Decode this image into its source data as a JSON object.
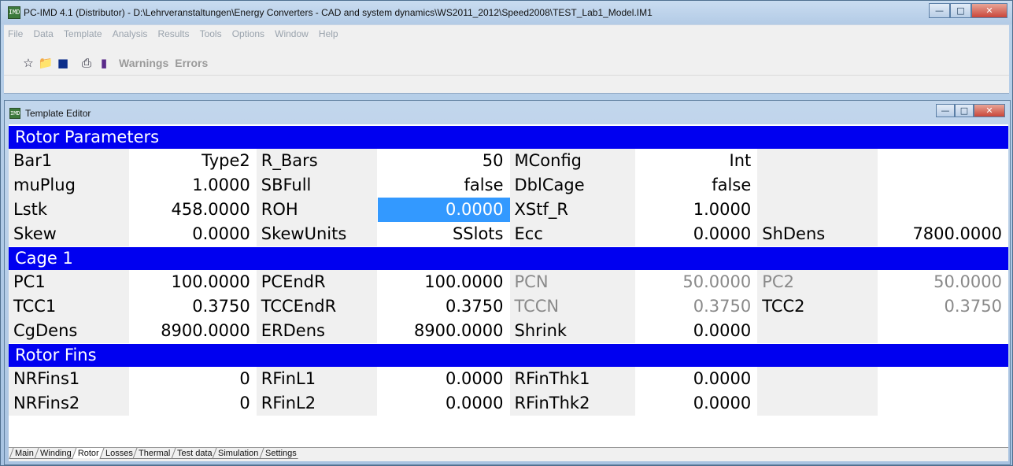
{
  "app": {
    "title": "PC-IMD 4.1 (Distributor) - D:\\Lehrveranstaltungen\\Energy Converters - CAD and system dynamics\\WS2011_2012\\Speed2008\\TEST_Lab1_Model.IM1",
    "icon_text": "IMD"
  },
  "menu": [
    "File",
    "Data",
    "Template",
    "Analysis",
    "Results",
    "Tools",
    "Options",
    "Window",
    "Help"
  ],
  "toolbar": {
    "icons": [
      "new-icon",
      "open-folder-icon",
      "save-icon",
      "print-icon",
      "data-icon"
    ],
    "warnings_label": "Warnings",
    "errors_label": "Errors"
  },
  "editor": {
    "title": "Template Editor",
    "sections": [
      {
        "title": "Rotor Parameters",
        "rows": [
          [
            [
              "Bar1",
              "Type2"
            ],
            [
              "R_Bars",
              "50"
            ],
            [
              "MConfig",
              "Int"
            ],
            [
              "",
              ""
            ]
          ],
          [
            [
              "muPlug",
              "1.0000"
            ],
            [
              "SBFull",
              "false"
            ],
            [
              "DblCage",
              "false"
            ],
            [
              "",
              ""
            ]
          ],
          [
            [
              "Lstk",
              "458.0000"
            ],
            [
              "ROH",
              "0.0000"
            ],
            [
              "XStf_R",
              "1.0000"
            ],
            [
              "",
              ""
            ]
          ],
          [
            [
              "Skew",
              "0.0000"
            ],
            [
              "SkewUnits",
              "SSlots"
            ],
            [
              "Ecc",
              "0.0000"
            ],
            [
              "ShDens",
              "7800.0000"
            ]
          ]
        ]
      },
      {
        "title": "Cage 1",
        "rows": [
          [
            [
              "PC1",
              "100.0000"
            ],
            [
              "PCEndR",
              "100.0000"
            ],
            [
              "PCN",
              "50.0000"
            ],
            [
              "PC2",
              "50.0000"
            ]
          ],
          [
            [
              "TCC1",
              "0.3750"
            ],
            [
              "TCCEndR",
              "0.3750"
            ],
            [
              "TCCN",
              "0.3750"
            ],
            [
              "TCC2",
              "0.3750"
            ]
          ],
          [
            [
              "CgDens",
              "8900.0000"
            ],
            [
              "ERDens",
              "8900.0000"
            ],
            [
              "Shrink",
              "0.0000"
            ],
            [
              "",
              ""
            ]
          ]
        ]
      },
      {
        "title": "Rotor Fins",
        "rows": [
          [
            [
              "NRFins1",
              "0"
            ],
            [
              "RFinL1",
              "0.0000"
            ],
            [
              "RFinThk1",
              "0.0000"
            ],
            [
              "",
              ""
            ]
          ],
          [
            [
              "NRFins2",
              "0"
            ],
            [
              "RFinL2",
              "0.0000"
            ],
            [
              "RFinThk2",
              "0.0000"
            ],
            [
              "",
              ""
            ]
          ]
        ]
      }
    ],
    "tabs": [
      "Main",
      "Winding",
      "Rotor",
      "Losses",
      "Thermal",
      "Test data",
      "Simulation",
      "Settings"
    ],
    "active_tab": "Rotor"
  }
}
